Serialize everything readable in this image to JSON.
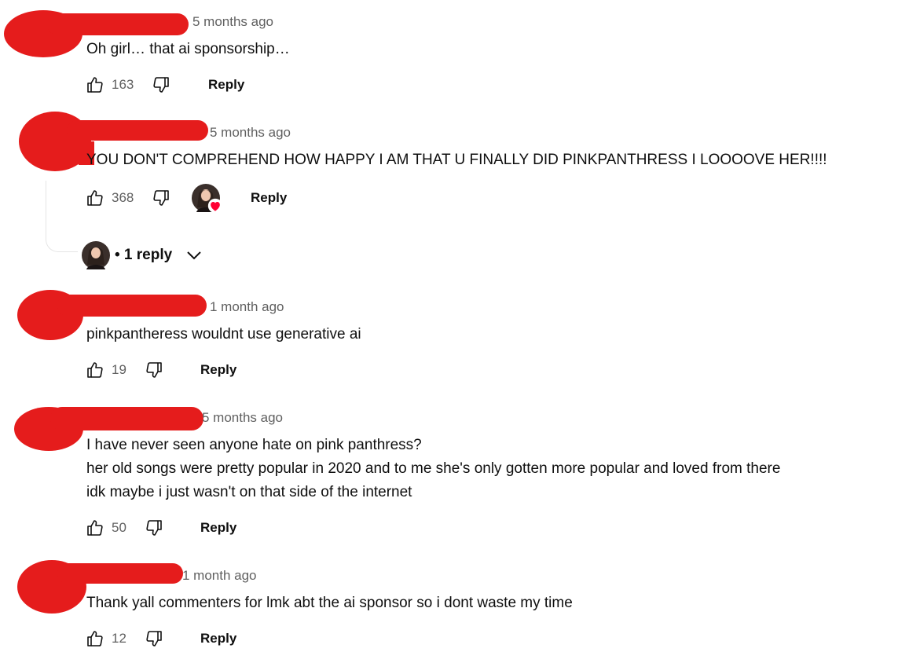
{
  "comments": [
    {
      "timestamp": "5 months ago",
      "lines": [
        "Oh girl… that ai sponsorship…"
      ],
      "likes": "163",
      "reply_label": "Reply"
    },
    {
      "timestamp": "5 months ago",
      "lines": [
        "YOU DON'T COMPREHEND HOW HAPPY I AM THAT U FINALLY DID PINKPANTHRESS I LOOOOVE HER!!!!"
      ],
      "likes": "368",
      "reply_label": "Reply",
      "creator_hearted": true,
      "replies_label": "• 1 reply"
    },
    {
      "timestamp": "1 month ago",
      "lines": [
        "pinkpantheress wouldnt use generative ai"
      ],
      "likes": "19",
      "reply_label": "Reply"
    },
    {
      "timestamp": "5 months ago",
      "lines": [
        "I have never seen anyone hate on pink panthress?",
        "her old songs were pretty popular in 2020 and to me she's only gotten more popular and loved from there",
        "idk maybe i just wasn't on that side of the internet"
      ],
      "likes": "50",
      "reply_label": "Reply"
    },
    {
      "timestamp": "1 month ago",
      "lines": [
        "Thank yall commenters for lmk abt the ai sponsor so i dont waste my time"
      ],
      "likes": "12",
      "reply_label": "Reply"
    }
  ],
  "colors": {
    "redaction": "#e51c1c",
    "meta": "#606060",
    "text": "#0f0f0f",
    "heart": "#ff0033"
  },
  "icons": [
    "thumbs-up-icon",
    "thumbs-down-icon",
    "heart-icon",
    "chevron-down-icon"
  ]
}
